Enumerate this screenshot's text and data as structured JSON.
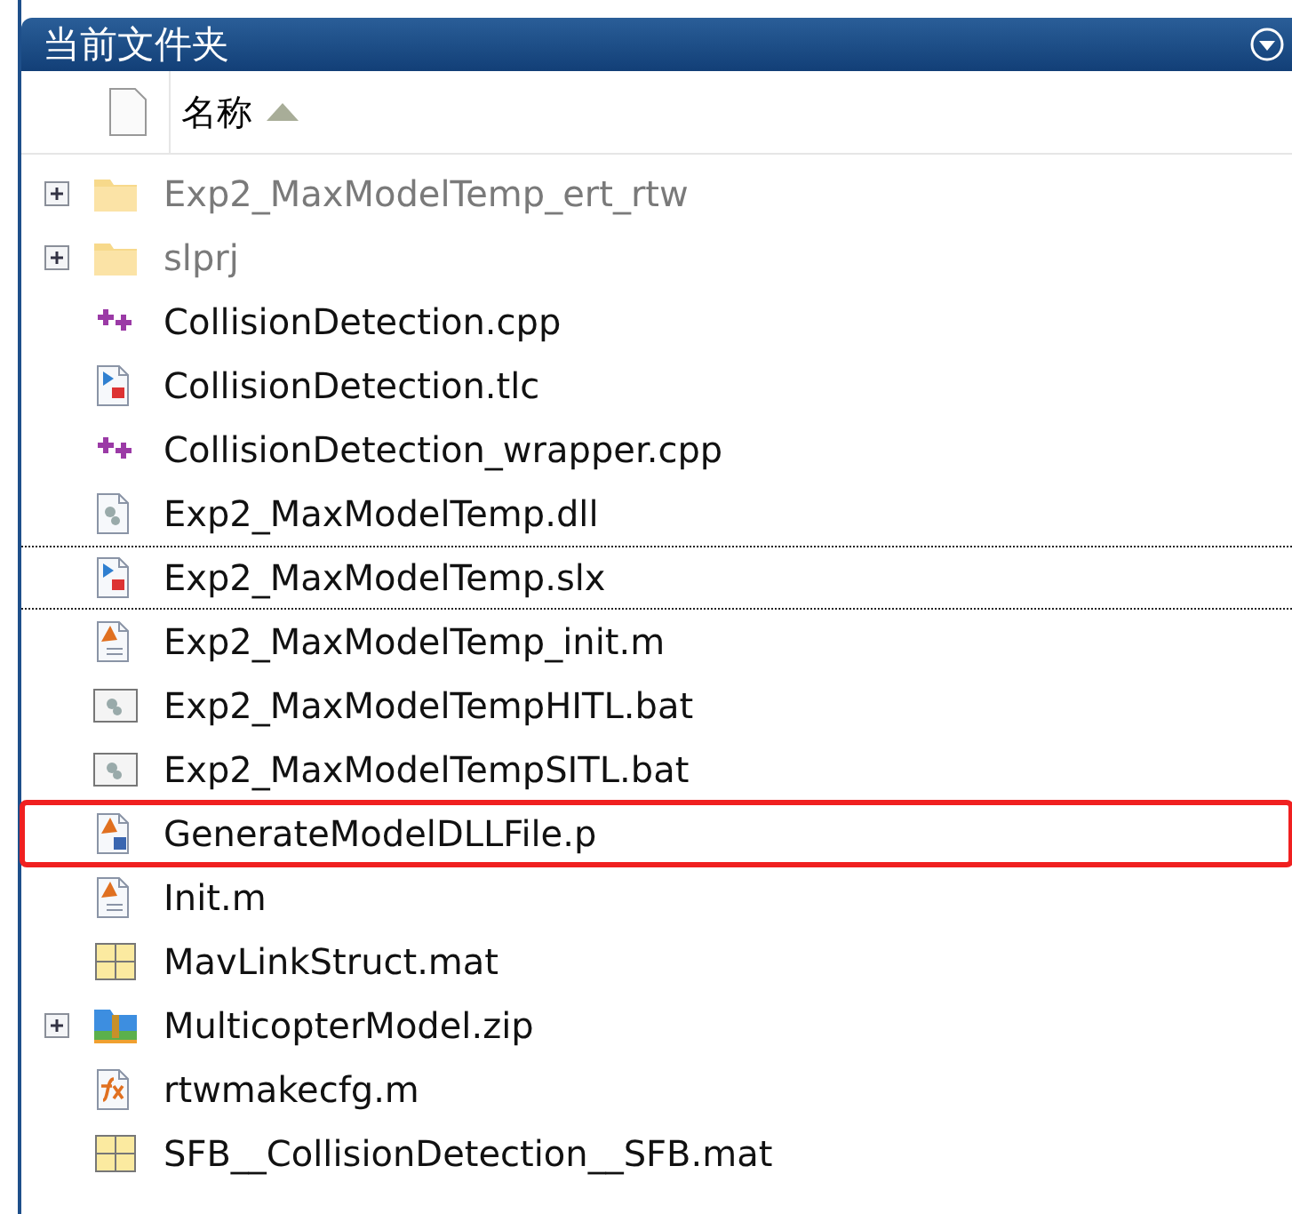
{
  "panel": {
    "title": "当前文件夹"
  },
  "columns": [
    {
      "label": "名称",
      "sort_ascending": true
    }
  ],
  "files": [
    {
      "name": "Exp2_MaxModelTemp_ert_rtw",
      "kind": "folder",
      "expandable": true,
      "focused": false,
      "highlighted": false
    },
    {
      "name": "slprj",
      "kind": "folder",
      "expandable": true,
      "focused": false,
      "highlighted": false
    },
    {
      "name": "CollisionDetection.cpp",
      "kind": "cpp",
      "expandable": false,
      "focused": false,
      "highlighted": false
    },
    {
      "name": "CollisionDetection.tlc",
      "kind": "model",
      "expandable": false,
      "focused": false,
      "highlighted": false
    },
    {
      "name": "CollisionDetection_wrapper.cpp",
      "kind": "cpp",
      "expandable": false,
      "focused": false,
      "highlighted": false
    },
    {
      "name": "Exp2_MaxModelTemp.dll",
      "kind": "dll",
      "expandable": false,
      "focused": false,
      "highlighted": false
    },
    {
      "name": "Exp2_MaxModelTemp.slx",
      "kind": "model",
      "expandable": false,
      "focused": true,
      "highlighted": false
    },
    {
      "name": "Exp2_MaxModelTemp_init.m",
      "kind": "script",
      "expandable": false,
      "focused": false,
      "highlighted": false
    },
    {
      "name": "Exp2_MaxModelTempHITL.bat",
      "kind": "bat",
      "expandable": false,
      "focused": false,
      "highlighted": false
    },
    {
      "name": "Exp2_MaxModelTempSITL.bat",
      "kind": "bat",
      "expandable": false,
      "focused": false,
      "highlighted": false
    },
    {
      "name": "GenerateModelDLLFile.p",
      "kind": "pcode",
      "expandable": false,
      "focused": false,
      "highlighted": true
    },
    {
      "name": "Init.m",
      "kind": "script",
      "expandable": false,
      "focused": false,
      "highlighted": false
    },
    {
      "name": "MavLinkStruct.mat",
      "kind": "mat",
      "expandable": false,
      "focused": false,
      "highlighted": false
    },
    {
      "name": "MulticopterModel.zip",
      "kind": "zip",
      "expandable": true,
      "focused": false,
      "highlighted": false
    },
    {
      "name": "rtwmakecfg.m",
      "kind": "function",
      "expandable": false,
      "focused": false,
      "highlighted": false
    },
    {
      "name": "SFB__CollisionDetection__SFB.mat",
      "kind": "mat",
      "expandable": false,
      "focused": false,
      "highlighted": false
    }
  ]
}
